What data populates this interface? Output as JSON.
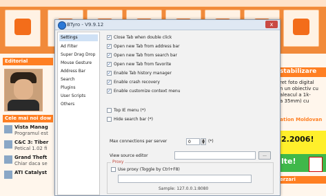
{
  "dialog": {
    "title": "BTyro - V9.9.12",
    "close_label": "x"
  },
  "nav": {
    "items": [
      {
        "label": "Settings",
        "selected": true
      },
      {
        "label": "Ad Filter",
        "selected": false
      },
      {
        "label": "Super Drag Drop",
        "selected": false
      },
      {
        "label": "Mouse Gesture",
        "selected": false
      },
      {
        "label": "Address Bar",
        "selected": false
      },
      {
        "label": "Search",
        "selected": false
      },
      {
        "label": "Plugins",
        "selected": false
      },
      {
        "label": "User Scripts",
        "selected": false
      },
      {
        "label": "Others",
        "selected": false
      }
    ]
  },
  "options": [
    {
      "label": "Close Tab when double click",
      "checked": true
    },
    {
      "label": "Open new Tab from address bar",
      "checked": true
    },
    {
      "label": "Open new Tab from search bar",
      "checked": true
    },
    {
      "label": "Open new Tab from favorite",
      "checked": true
    },
    {
      "label": "Enable Tab history manager",
      "checked": true
    },
    {
      "label": "Enable crash recovery",
      "checked": true
    },
    {
      "label": "Enable customize context menu",
      "checked": true
    }
  ],
  "options2": [
    {
      "label": "Top IE menu (*)",
      "checked": false
    },
    {
      "label": "Hide search bar (*)",
      "checked": false
    }
  ],
  "max_connections": {
    "label": "Max connections per server",
    "value": "0",
    "suffix": "(*)"
  },
  "view_source": {
    "label": "View source editor",
    "value": "",
    "browse_label": "..."
  },
  "proxy": {
    "legend": "Proxy",
    "toggle_label": "Use proxy (Toggle by Ctrl+F8)",
    "toggle_checked": false,
    "value": "",
    "sample": "Sample: 127.0.0.1:8080"
  },
  "background": {
    "editorial": "Editorial",
    "cine": "Cele mai noi dow",
    "news": [
      {
        "title": "Vista Manag",
        "sub": "Programul est"
      },
      {
        "title": "C&C 3: Tiber",
        "sub": "Petical 1.02 fi"
      },
      {
        "title": "Grand Theft",
        "sub": "Chiar daca se"
      },
      {
        "title": "ATI Catalyst",
        "sub": ""
      }
    ],
    "right_head": "stabilizare",
    "right_lines": [
      "ret foto digital",
      "n un obiectiv cu",
      "aleacul a 1k-",
      "a 35mm) cu"
    ],
    "right_mid": "lation Moldovan",
    "right_yellow": "2.2006!",
    "right_green": "lte!",
    "right_bar": "erzari"
  },
  "colors": {
    "accent": "#ff7f22",
    "selected_nav": "#cfe1f5",
    "proxy_legend": "#c0463a"
  }
}
